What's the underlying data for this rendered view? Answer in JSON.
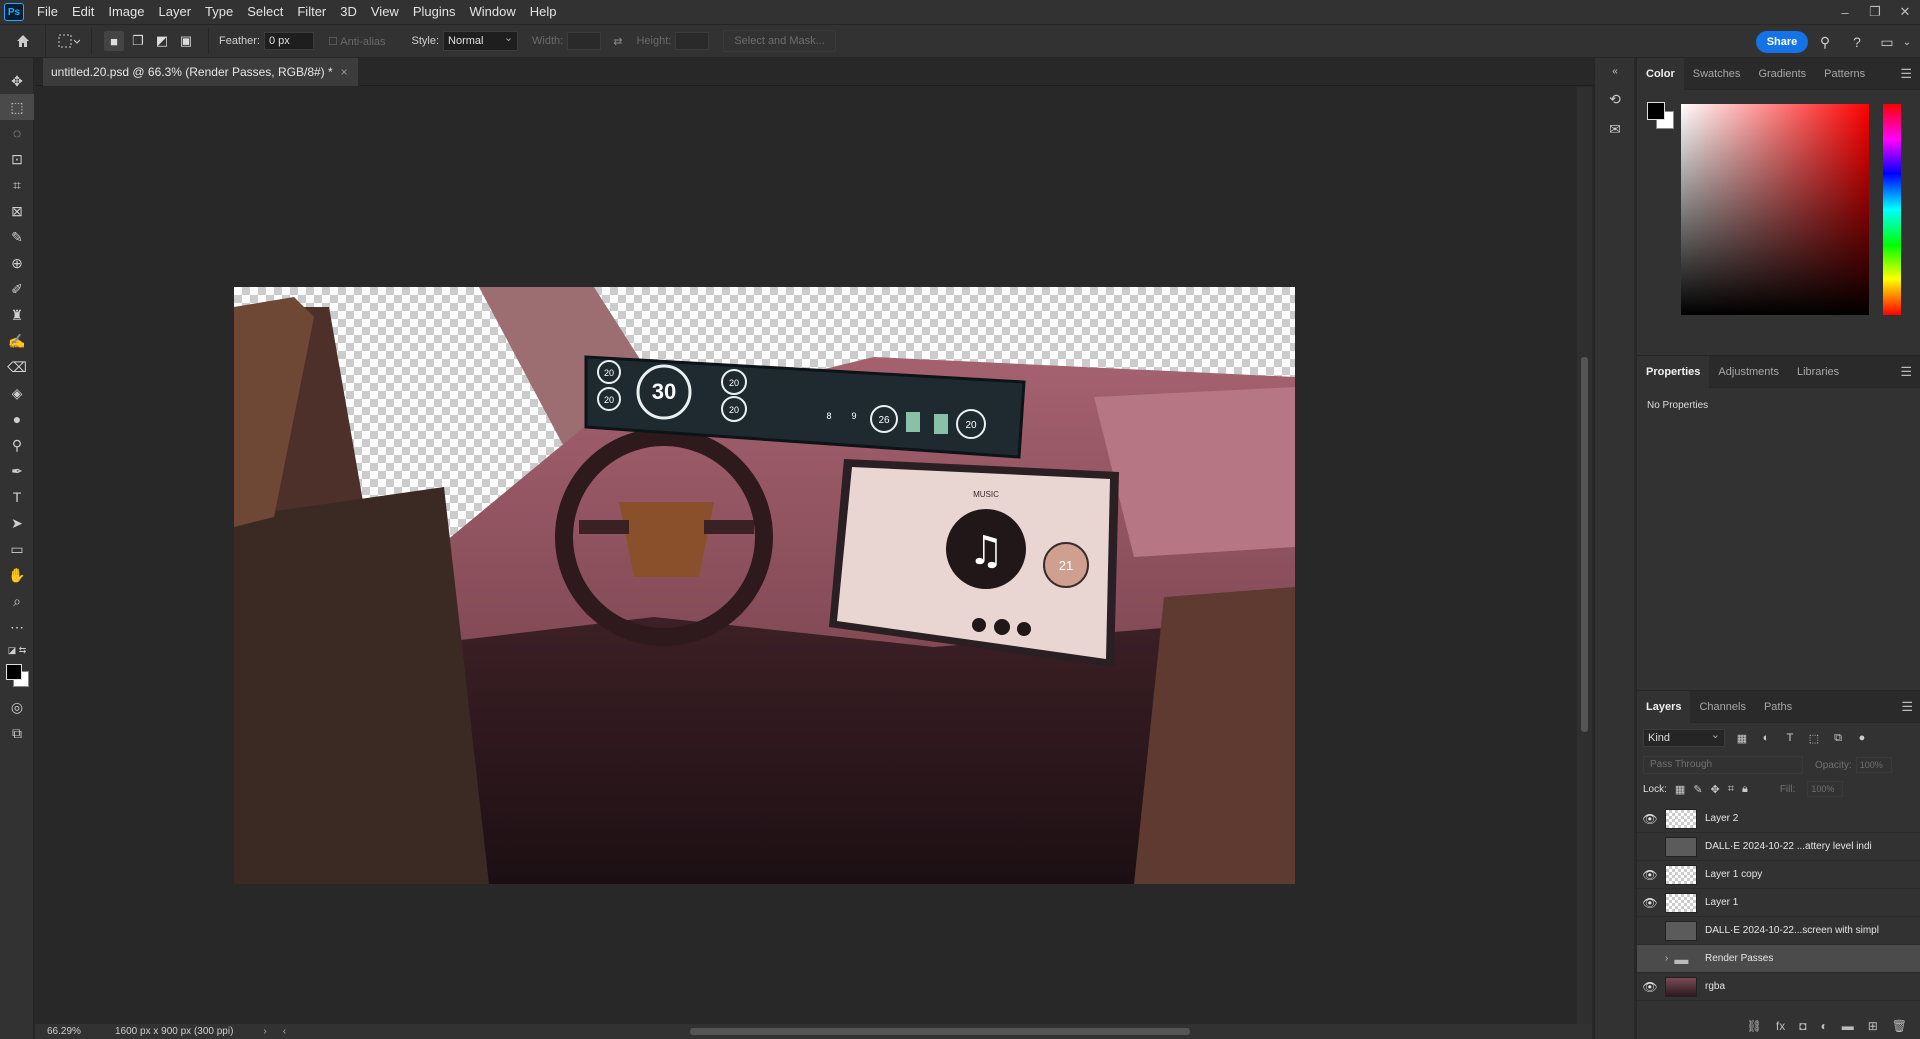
{
  "app": {
    "logo": "Ps"
  },
  "menu": [
    "File",
    "Edit",
    "Image",
    "Layer",
    "Type",
    "Select",
    "Filter",
    "3D",
    "View",
    "Plugins",
    "Window",
    "Help"
  ],
  "window_controls": {
    "minimize": "–",
    "restore": "❐",
    "close": "✕"
  },
  "options": {
    "feather_label": "Feather:",
    "feather_value": "0 px",
    "antialias_label": "Anti-alias",
    "style_label": "Style:",
    "style_value": "Normal",
    "width_label": "Width:",
    "height_label": "Height:",
    "select_mask": "Select and Mask...",
    "share": "Share"
  },
  "document": {
    "tab_title": "untitled.20.psd @ 66.3% (Render Passes, RGB/8#) *",
    "close": "×"
  },
  "status": {
    "zoom": "66.29%",
    "info": "1600 px x 900 px (300 ppi)"
  },
  "color_panel": {
    "tabs": [
      "Color",
      "Swatches",
      "Gradients",
      "Patterns"
    ],
    "foreground": "#000000",
    "background": "#ffffff"
  },
  "properties_panel": {
    "tabs": [
      "Properties",
      "Adjustments",
      "Libraries"
    ],
    "empty_text": "No Properties"
  },
  "layers_panel": {
    "tabs": [
      "Layers",
      "Channels",
      "Paths"
    ],
    "filter_kind": "Kind",
    "blend_mode": "Pass Through",
    "opacity_label": "Opacity:",
    "opacity_value": "100%",
    "lock_label": "Lock:",
    "fill_label": "Fill:",
    "fill_value": "100%",
    "layers": [
      {
        "name": "Layer 2",
        "visible": true,
        "thumb": "transparent"
      },
      {
        "name": "DALL·E 2024-10-22 ...attery level indi",
        "visible": false,
        "thumb": "photo"
      },
      {
        "name": "Layer 1 copy",
        "visible": true,
        "thumb": "transparent"
      },
      {
        "name": "Layer 1",
        "visible": true,
        "thumb": "transparent"
      },
      {
        "name": "DALL·E 2024-10-22...screen with simpl",
        "visible": false,
        "thumb": "photo"
      },
      {
        "name": "Render Passes",
        "visible": false,
        "thumb": "folder",
        "selected": true
      },
      {
        "name": "rgba",
        "visible": true,
        "thumb": "rgba"
      }
    ]
  },
  "artwork": {
    "cluster_big": "30",
    "cluster_small": [
      "20",
      "20",
      "20",
      "20",
      "26",
      "20",
      "8",
      "9"
    ],
    "infotainment_title": "MUSIC",
    "infotainment_temp": "21"
  }
}
